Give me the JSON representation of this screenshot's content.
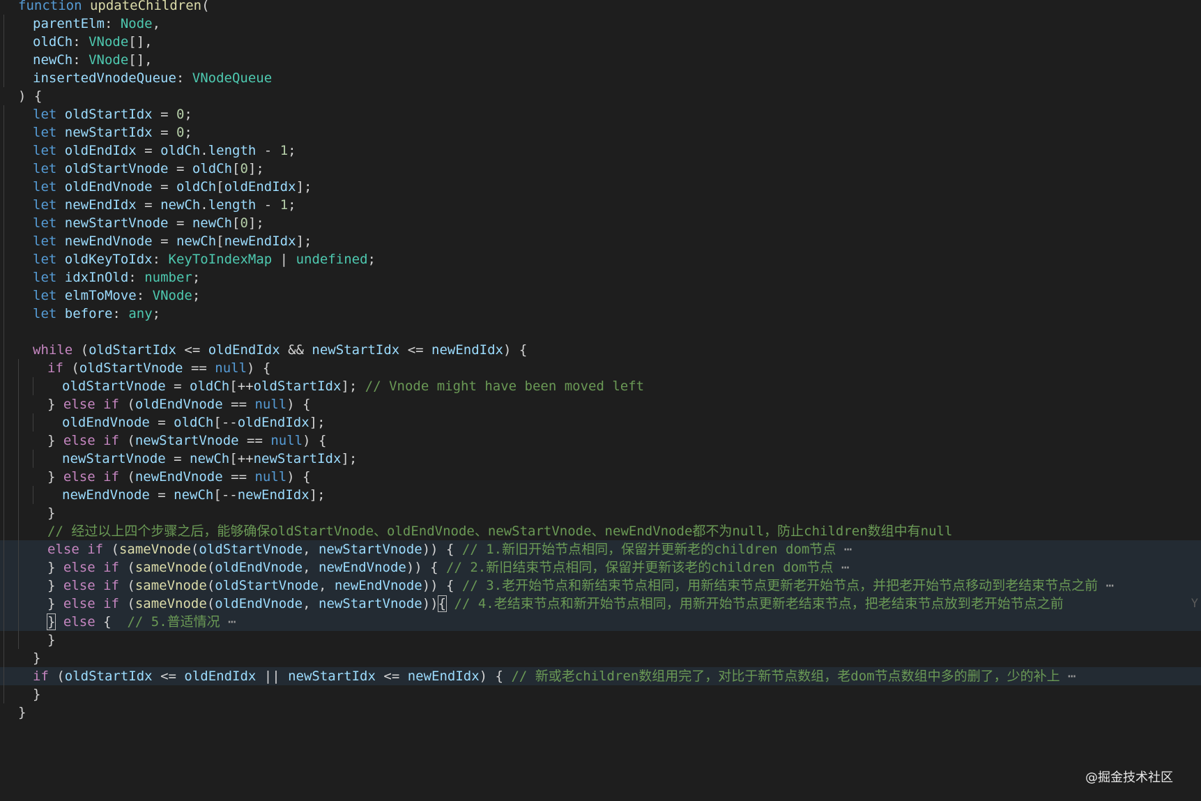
{
  "editor": {
    "language": "typescript",
    "theme_colors": {
      "background": "#1e1e1e",
      "keyword": "#569cd6",
      "control": "#c586c0",
      "function": "#dcdcaa",
      "variable": "#9cdcfe",
      "type": "#4ec9b0",
      "number": "#b5cea8",
      "comment": "#6a9955",
      "highlight": "#232b33"
    },
    "lines": [
      {
        "indent": 0,
        "hl": false,
        "tokens": [
          [
            "kw",
            "function"
          ],
          [
            "p",
            " "
          ],
          [
            "fn",
            "updateChildren"
          ],
          [
            "p",
            "("
          ]
        ]
      },
      {
        "indent": 1,
        "hl": false,
        "tokens": [
          [
            "var",
            "parentElm"
          ],
          [
            "p",
            ": "
          ],
          [
            "type",
            "Node"
          ],
          [
            "p",
            ","
          ]
        ]
      },
      {
        "indent": 1,
        "hl": false,
        "tokens": [
          [
            "var",
            "oldCh"
          ],
          [
            "p",
            ": "
          ],
          [
            "type",
            "VNode"
          ],
          [
            "p",
            "[],"
          ]
        ]
      },
      {
        "indent": 1,
        "hl": false,
        "tokens": [
          [
            "var",
            "newCh"
          ],
          [
            "p",
            ": "
          ],
          [
            "type",
            "VNode"
          ],
          [
            "p",
            "[],"
          ]
        ]
      },
      {
        "indent": 1,
        "hl": false,
        "tokens": [
          [
            "var",
            "insertedVnodeQueue"
          ],
          [
            "p",
            ": "
          ],
          [
            "type",
            "VNodeQueue"
          ]
        ]
      },
      {
        "indent": 0,
        "hl": false,
        "tokens": [
          [
            "p",
            ") {"
          ]
        ]
      },
      {
        "indent": 1,
        "hl": false,
        "tokens": [
          [
            "kw",
            "let"
          ],
          [
            "p",
            " "
          ],
          [
            "var",
            "oldStartIdx"
          ],
          [
            "p",
            " = "
          ],
          [
            "num",
            "0"
          ],
          [
            "p",
            ";"
          ]
        ]
      },
      {
        "indent": 1,
        "hl": false,
        "tokens": [
          [
            "kw",
            "let"
          ],
          [
            "p",
            " "
          ],
          [
            "var",
            "newStartIdx"
          ],
          [
            "p",
            " = "
          ],
          [
            "num",
            "0"
          ],
          [
            "p",
            ";"
          ]
        ]
      },
      {
        "indent": 1,
        "hl": false,
        "tokens": [
          [
            "kw",
            "let"
          ],
          [
            "p",
            " "
          ],
          [
            "var",
            "oldEndIdx"
          ],
          [
            "p",
            " = "
          ],
          [
            "var",
            "oldCh"
          ],
          [
            "p",
            "."
          ],
          [
            "var",
            "length"
          ],
          [
            "p",
            " - "
          ],
          [
            "num",
            "1"
          ],
          [
            "p",
            ";"
          ]
        ]
      },
      {
        "indent": 1,
        "hl": false,
        "tokens": [
          [
            "kw",
            "let"
          ],
          [
            "p",
            " "
          ],
          [
            "var",
            "oldStartVnode"
          ],
          [
            "p",
            " = "
          ],
          [
            "var",
            "oldCh"
          ],
          [
            "p",
            "["
          ],
          [
            "num",
            "0"
          ],
          [
            "p",
            "];"
          ]
        ]
      },
      {
        "indent": 1,
        "hl": false,
        "tokens": [
          [
            "kw",
            "let"
          ],
          [
            "p",
            " "
          ],
          [
            "var",
            "oldEndVnode"
          ],
          [
            "p",
            " = "
          ],
          [
            "var",
            "oldCh"
          ],
          [
            "p",
            "["
          ],
          [
            "var",
            "oldEndIdx"
          ],
          [
            "p",
            "];"
          ]
        ]
      },
      {
        "indent": 1,
        "hl": false,
        "tokens": [
          [
            "kw",
            "let"
          ],
          [
            "p",
            " "
          ],
          [
            "var",
            "newEndIdx"
          ],
          [
            "p",
            " = "
          ],
          [
            "var",
            "newCh"
          ],
          [
            "p",
            "."
          ],
          [
            "var",
            "length"
          ],
          [
            "p",
            " - "
          ],
          [
            "num",
            "1"
          ],
          [
            "p",
            ";"
          ]
        ]
      },
      {
        "indent": 1,
        "hl": false,
        "tokens": [
          [
            "kw",
            "let"
          ],
          [
            "p",
            " "
          ],
          [
            "var",
            "newStartVnode"
          ],
          [
            "p",
            " = "
          ],
          [
            "var",
            "newCh"
          ],
          [
            "p",
            "["
          ],
          [
            "num",
            "0"
          ],
          [
            "p",
            "];"
          ]
        ]
      },
      {
        "indent": 1,
        "hl": false,
        "tokens": [
          [
            "kw",
            "let"
          ],
          [
            "p",
            " "
          ],
          [
            "var",
            "newEndVnode"
          ],
          [
            "p",
            " = "
          ],
          [
            "var",
            "newCh"
          ],
          [
            "p",
            "["
          ],
          [
            "var",
            "newEndIdx"
          ],
          [
            "p",
            "];"
          ]
        ]
      },
      {
        "indent": 1,
        "hl": false,
        "tokens": [
          [
            "kw",
            "let"
          ],
          [
            "p",
            " "
          ],
          [
            "var",
            "oldKeyToIdx"
          ],
          [
            "p",
            ": "
          ],
          [
            "type",
            "KeyToIndexMap"
          ],
          [
            "p",
            " | "
          ],
          [
            "type",
            "undefined"
          ],
          [
            "p",
            ";"
          ]
        ]
      },
      {
        "indent": 1,
        "hl": false,
        "tokens": [
          [
            "kw",
            "let"
          ],
          [
            "p",
            " "
          ],
          [
            "var",
            "idxInOld"
          ],
          [
            "p",
            ": "
          ],
          [
            "type",
            "number"
          ],
          [
            "p",
            ";"
          ]
        ]
      },
      {
        "indent": 1,
        "hl": false,
        "tokens": [
          [
            "kw",
            "let"
          ],
          [
            "p",
            " "
          ],
          [
            "var",
            "elmToMove"
          ],
          [
            "p",
            ": "
          ],
          [
            "type",
            "VNode"
          ],
          [
            "p",
            ";"
          ]
        ]
      },
      {
        "indent": 1,
        "hl": false,
        "tokens": [
          [
            "kw",
            "let"
          ],
          [
            "p",
            " "
          ],
          [
            "var",
            "before"
          ],
          [
            "p",
            ": "
          ],
          [
            "type",
            "any"
          ],
          [
            "p",
            ";"
          ]
        ]
      },
      {
        "indent": 1,
        "hl": false,
        "tokens": []
      },
      {
        "indent": 1,
        "hl": false,
        "tokens": [
          [
            "ctrl",
            "while"
          ],
          [
            "p",
            " ("
          ],
          [
            "var",
            "oldStartIdx"
          ],
          [
            "p",
            " <= "
          ],
          [
            "var",
            "oldEndIdx"
          ],
          [
            "p",
            " && "
          ],
          [
            "var",
            "newStartIdx"
          ],
          [
            "p",
            " <= "
          ],
          [
            "var",
            "newEndIdx"
          ],
          [
            "p",
            ") {"
          ]
        ]
      },
      {
        "indent": 2,
        "hl": false,
        "tokens": [
          [
            "ctrl",
            "if"
          ],
          [
            "p",
            " ("
          ],
          [
            "var",
            "oldStartVnode"
          ],
          [
            "p",
            " == "
          ],
          [
            "kw",
            "null"
          ],
          [
            "p",
            ") {"
          ]
        ]
      },
      {
        "indent": 3,
        "hl": false,
        "tokens": [
          [
            "var",
            "oldStartVnode"
          ],
          [
            "p",
            " = "
          ],
          [
            "var",
            "oldCh"
          ],
          [
            "p",
            "[++"
          ],
          [
            "var",
            "oldStartIdx"
          ],
          [
            "p",
            "]; "
          ],
          [
            "cmt",
            "// Vnode might have been moved left"
          ]
        ]
      },
      {
        "indent": 2,
        "hl": false,
        "tokens": [
          [
            "p",
            "} "
          ],
          [
            "ctrl",
            "else if"
          ],
          [
            "p",
            " ("
          ],
          [
            "var",
            "oldEndVnode"
          ],
          [
            "p",
            " == "
          ],
          [
            "kw",
            "null"
          ],
          [
            "p",
            ") {"
          ]
        ]
      },
      {
        "indent": 3,
        "hl": false,
        "tokens": [
          [
            "var",
            "oldEndVnode"
          ],
          [
            "p",
            " = "
          ],
          [
            "var",
            "oldCh"
          ],
          [
            "p",
            "[--"
          ],
          [
            "var",
            "oldEndIdx"
          ],
          [
            "p",
            "];"
          ]
        ]
      },
      {
        "indent": 2,
        "hl": false,
        "tokens": [
          [
            "p",
            "} "
          ],
          [
            "ctrl",
            "else if"
          ],
          [
            "p",
            " ("
          ],
          [
            "var",
            "newStartVnode"
          ],
          [
            "p",
            " == "
          ],
          [
            "kw",
            "null"
          ],
          [
            "p",
            ") {"
          ]
        ]
      },
      {
        "indent": 3,
        "hl": false,
        "tokens": [
          [
            "var",
            "newStartVnode"
          ],
          [
            "p",
            " = "
          ],
          [
            "var",
            "newCh"
          ],
          [
            "p",
            "[++"
          ],
          [
            "var",
            "newStartIdx"
          ],
          [
            "p",
            "];"
          ]
        ]
      },
      {
        "indent": 2,
        "hl": false,
        "tokens": [
          [
            "p",
            "} "
          ],
          [
            "ctrl",
            "else if"
          ],
          [
            "p",
            " ("
          ],
          [
            "var",
            "newEndVnode"
          ],
          [
            "p",
            " == "
          ],
          [
            "kw",
            "null"
          ],
          [
            "p",
            ") {"
          ]
        ]
      },
      {
        "indent": 3,
        "hl": false,
        "tokens": [
          [
            "var",
            "newEndVnode"
          ],
          [
            "p",
            " = "
          ],
          [
            "var",
            "newCh"
          ],
          [
            "p",
            "[--"
          ],
          [
            "var",
            "newEndIdx"
          ],
          [
            "p",
            "];"
          ]
        ]
      },
      {
        "indent": 2,
        "hl": false,
        "tokens": [
          [
            "p",
            "}"
          ]
        ]
      },
      {
        "indent": 2,
        "hl": false,
        "tokens": [
          [
            "cmt",
            "// 经过以上四个步骤之后，能够确保oldStartVnode、oldEndVnode、newStartVnode、newEndVnode都不为null，防止children数组中有null"
          ]
        ]
      },
      {
        "indent": 2,
        "hl": true,
        "tokens": [
          [
            "ctrl",
            "else if"
          ],
          [
            "p",
            " ("
          ],
          [
            "fn",
            "sameVnode"
          ],
          [
            "p",
            "("
          ],
          [
            "var",
            "oldStartVnode"
          ],
          [
            "p",
            ", "
          ],
          [
            "var",
            "newStartVnode"
          ],
          [
            "p",
            ")) { "
          ],
          [
            "cmt",
            "// 1.新旧开始节点相同，保留并更新老的children dom节点"
          ],
          [
            "fold",
            " ⋯"
          ]
        ]
      },
      {
        "indent": 2,
        "hl": true,
        "tokens": [
          [
            "p",
            "} "
          ],
          [
            "ctrl",
            "else if"
          ],
          [
            "p",
            " ("
          ],
          [
            "fn",
            "sameVnode"
          ],
          [
            "p",
            "("
          ],
          [
            "var",
            "oldEndVnode"
          ],
          [
            "p",
            ", "
          ],
          [
            "var",
            "newEndVnode"
          ],
          [
            "p",
            ")) { "
          ],
          [
            "cmt",
            "// 2.新旧结束节点相同，保留并更新该老的children dom节点"
          ],
          [
            "fold",
            " ⋯"
          ]
        ]
      },
      {
        "indent": 2,
        "hl": true,
        "tokens": [
          [
            "p",
            "} "
          ],
          [
            "ctrl",
            "else if"
          ],
          [
            "p",
            " ("
          ],
          [
            "fn",
            "sameVnode"
          ],
          [
            "p",
            "("
          ],
          [
            "var",
            "oldStartVnode"
          ],
          [
            "p",
            ", "
          ],
          [
            "var",
            "newEndVnode"
          ],
          [
            "p",
            ")) { "
          ],
          [
            "cmt",
            "// 3.老开始节点和新结束节点相同，用新结束节点更新老开始节点，并把老开始节点移动到老结束节点之前"
          ],
          [
            "fold",
            " ⋯"
          ]
        ]
      },
      {
        "indent": 2,
        "hl": true,
        "tokens": [
          [
            "p",
            "} "
          ],
          [
            "ctrl",
            "else if"
          ],
          [
            "p",
            " ("
          ],
          [
            "fn",
            "sameVnode"
          ],
          [
            "p",
            "("
          ],
          [
            "var",
            "oldEndVnode"
          ],
          [
            "p",
            ", "
          ],
          [
            "var",
            "newStartVnode"
          ],
          [
            "p",
            "))"
          ],
          [
            "pbox",
            "{"
          ],
          [
            "p",
            " "
          ],
          [
            "cmt",
            "// 4.老结束节点和新开始节点相同，用新开始节点更新老结束节点，把老结束节点放到老开始节点之前"
          ]
        ]
      },
      {
        "indent": 2,
        "hl": true,
        "tokens": [
          [
            "pbox",
            "}"
          ],
          [
            "p",
            " "
          ],
          [
            "ctrl",
            "else"
          ],
          [
            "p",
            " {  "
          ],
          [
            "cmt",
            "// 5.普适情况"
          ],
          [
            "fold",
            " ⋯"
          ]
        ]
      },
      {
        "indent": 2,
        "hl": false,
        "tokens": [
          [
            "p",
            "}"
          ]
        ]
      },
      {
        "indent": 1,
        "hl": false,
        "tokens": [
          [
            "p",
            "}"
          ]
        ]
      },
      {
        "indent": 1,
        "hl": true,
        "tokens": [
          [
            "ctrl",
            "if"
          ],
          [
            "p",
            " ("
          ],
          [
            "var",
            "oldStartIdx"
          ],
          [
            "p",
            " <= "
          ],
          [
            "var",
            "oldEndIdx"
          ],
          [
            "p",
            " || "
          ],
          [
            "var",
            "newStartIdx"
          ],
          [
            "p",
            " <= "
          ],
          [
            "var",
            "newEndIdx"
          ],
          [
            "p",
            ") { "
          ],
          [
            "cmt",
            "// 新或老children数组用完了，对比于新节点数组，老dom节点数组中多的删了，少的补上"
          ],
          [
            "fold",
            " ⋯"
          ]
        ]
      },
      {
        "indent": 1,
        "hl": false,
        "tokens": [
          [
            "p",
            "}"
          ]
        ]
      },
      {
        "indent": 0,
        "hl": false,
        "tokens": [
          [
            "p",
            "}"
          ]
        ]
      }
    ]
  },
  "watermark": "@掘金技术社区",
  "edge_glyph": "Y"
}
